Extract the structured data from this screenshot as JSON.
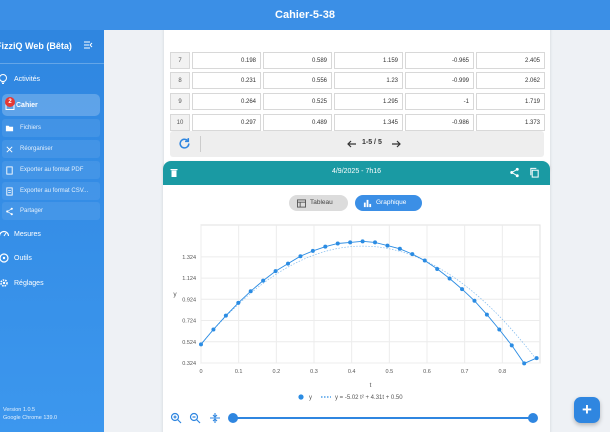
{
  "topbar": {
    "title": "Cahier-5-38"
  },
  "sidebar": {
    "brand": "FizziQ Web (Bêta)",
    "items": [
      {
        "label": "Activités",
        "icon": "lightbulb-icon"
      },
      {
        "label": "Cahier",
        "icon": "notebook-icon",
        "badge": "2",
        "active": true
      },
      {
        "label": "Fichiers",
        "icon": "folder-icon",
        "sub": true
      },
      {
        "label": "Réorganiser",
        "icon": "reorder-icon",
        "sub": true
      },
      {
        "label": "Exporter au format PDF",
        "icon": "pdf-icon",
        "sub": true
      },
      {
        "label": "Exporter au format CSV...",
        "icon": "csv-icon",
        "sub": true
      },
      {
        "label": "Partager",
        "icon": "share-icon",
        "sub": true
      },
      {
        "label": "Mesures",
        "icon": "gauge-icon"
      },
      {
        "label": "Outils",
        "icon": "tools-icon"
      },
      {
        "label": "Réglages",
        "icon": "settings-icon"
      }
    ],
    "version": "Version 1.0.5",
    "browser": "Google Chrome 139.0"
  },
  "table": {
    "rows": [
      {
        "idx": "7",
        "cols": [
          "0.198",
          "0.589",
          "1.159",
          "-0.965",
          "2.405"
        ]
      },
      {
        "idx": "8",
        "cols": [
          "0.231",
          "0.556",
          "1.23",
          "-0.999",
          "2.062"
        ]
      },
      {
        "idx": "9",
        "cols": [
          "0.264",
          "0.525",
          "1.295",
          "-1",
          "1.719"
        ]
      },
      {
        "idx": "10",
        "cols": [
          "0.297",
          "0.489",
          "1.345",
          "-0.986",
          "1.373"
        ]
      }
    ],
    "pager_text": "1-5 / 5"
  },
  "chart_card": {
    "date": "4/9/2025 - 7h16",
    "tab_table": "Tableau",
    "tab_graph": "Graphique",
    "fab": "+"
  },
  "colors": {
    "accent": "#3b8fe6",
    "teal": "#1a9aa3",
    "series": "#2b8ce3"
  },
  "chart_data": {
    "type": "scatter",
    "title": "",
    "xlabel": "t",
    "ylabel": "y",
    "xlim": [
      0,
      0.9
    ],
    "ylim": [
      0.324,
      1.624
    ],
    "xticks": [
      "0",
      "0.1",
      "0.2",
      "0.3",
      "0.4",
      "0.5",
      "0.6",
      "0.7",
      "0.8"
    ],
    "yticks": [
      "0.324",
      "0.524",
      "0.724",
      "0.924",
      "1.124",
      "1.324"
    ],
    "x": [
      0,
      0.033,
      0.066,
      0.099,
      0.132,
      0.165,
      0.198,
      0.231,
      0.264,
      0.297,
      0.33,
      0.363,
      0.396,
      0.429,
      0.462,
      0.495,
      0.528,
      0.561,
      0.594,
      0.627,
      0.66,
      0.693,
      0.726,
      0.759,
      0.792,
      0.825,
      0.858,
      0.891
    ],
    "y": [
      0.5,
      0.64,
      0.77,
      0.89,
      1.0,
      1.1,
      1.19,
      1.26,
      1.33,
      1.38,
      1.42,
      1.45,
      1.46,
      1.47,
      1.46,
      1.43,
      1.4,
      1.35,
      1.29,
      1.21,
      1.12,
      1.02,
      0.91,
      0.78,
      0.64,
      0.49,
      0.32,
      0.37
    ],
    "series": [
      {
        "name": "y"
      },
      {
        "name": "y = -5.02 t² + 4.31t + 0.50"
      }
    ],
    "fit": {
      "a": -5.02,
      "b": 4.31,
      "c": 0.5
    },
    "legend": "bottom"
  }
}
